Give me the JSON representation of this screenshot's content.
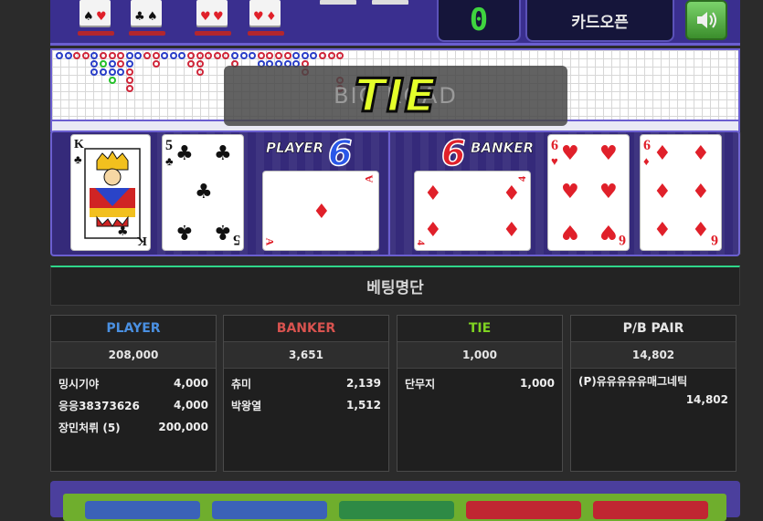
{
  "top": {
    "score": "0",
    "card_open_label": "카드오픈",
    "sound_icon": "speaker-icon"
  },
  "road": {
    "ghost_text": "BIG ROAD",
    "result_text": "TIE"
  },
  "table": {
    "player_label": "PLAYER",
    "player_score": "6",
    "banker_label": "BANKER",
    "banker_score": "6",
    "player_cards": [
      {
        "rank": "K",
        "suit": "♣",
        "color": "#111111"
      },
      {
        "rank": "5",
        "suit": "♣",
        "color": "#111111"
      },
      {
        "rank": "A",
        "suit": "♦",
        "color": "#e0202a"
      }
    ],
    "banker_cards": [
      {
        "rank": "4",
        "suit": "♦",
        "color": "#e0202a"
      },
      {
        "rank": "6",
        "suit": "♥",
        "color": "#e0202a"
      },
      {
        "rank": "6",
        "suit": "♦",
        "color": "#e0202a"
      }
    ]
  },
  "betting": {
    "title": "베팅명단",
    "columns": [
      {
        "header": "PLAYER",
        "color": "#4a90e2",
        "total": "208,000",
        "rows": [
          {
            "name": "밍시기야",
            "amount": "4,000"
          },
          {
            "name": "응응38373626",
            "amount": "4,000"
          },
          {
            "name": "장민처뤼 (5)",
            "amount": "200,000"
          }
        ]
      },
      {
        "header": "BANKER",
        "color": "#d9534f",
        "total": "3,651",
        "rows": [
          {
            "name": "츄미",
            "amount": "2,139"
          },
          {
            "name": "박왕열",
            "amount": "1,512"
          }
        ]
      },
      {
        "header": "TIE",
        "color": "#7ed321",
        "total": "1,000",
        "rows": [
          {
            "name": "단무지",
            "amount": "1,000"
          }
        ]
      },
      {
        "header": "P/B PAIR",
        "color": "#e6e6e6",
        "total": "14,802",
        "pair_row": {
          "name": "(P)유유유유유매그네틱",
          "amount": "14,802"
        }
      }
    ]
  },
  "colors": {
    "purple": "#3a2f8f",
    "tie_yellow": "#e4ff2a",
    "accent_green": "#2fd68a"
  }
}
